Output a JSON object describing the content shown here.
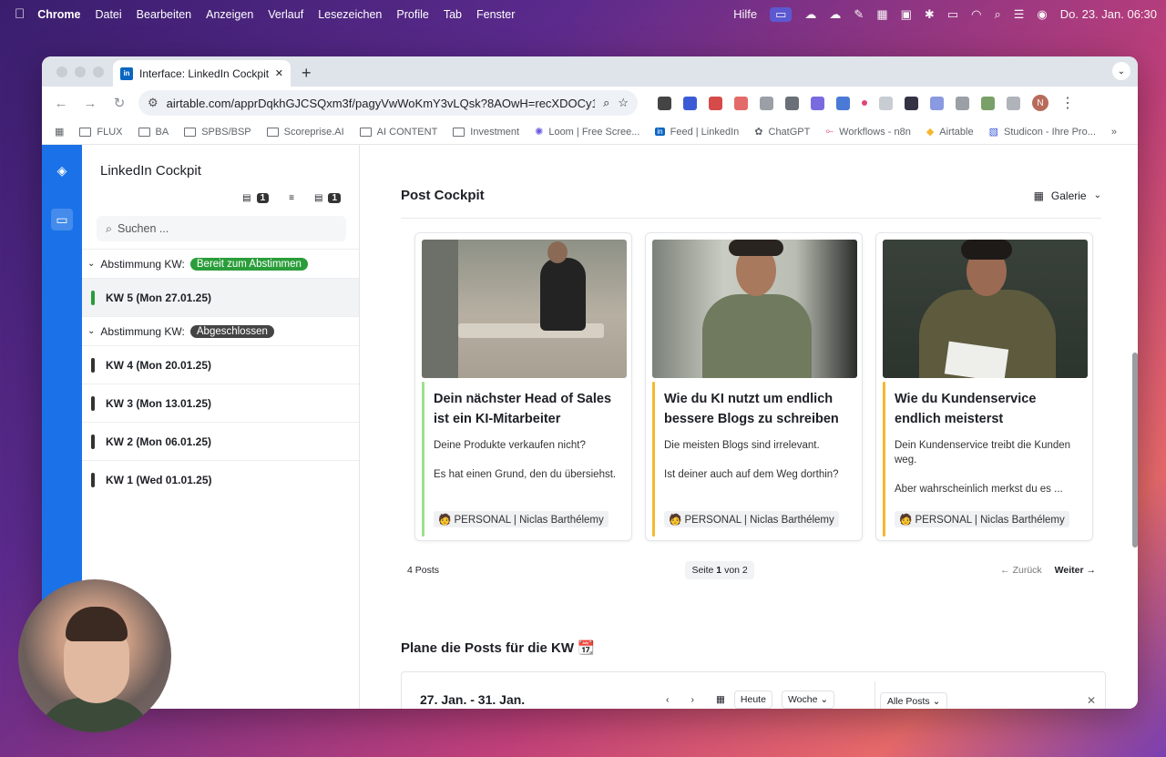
{
  "menubar": {
    "apple": "",
    "app": "Chrome",
    "items": [
      "Datei",
      "Bearbeiten",
      "Anzeigen",
      "Verlauf",
      "Lesezeichen",
      "Profile",
      "Tab",
      "Fenster"
    ],
    "help": "Hilfe",
    "datetime": "Do. 23. Jan.  06:30"
  },
  "browser": {
    "tab_title": "Interface: LinkedIn Cockpit - ",
    "tab_close": "✕",
    "new_tab": "+",
    "url": "airtable.com/apprDqkhGJCSQxm3f/pagyVwWoKmY3vLQsk?8AOwH=recXDOCy1...",
    "profile": "N",
    "bookmarks": [
      "FLUX",
      "BA",
      "SPBS/BSP",
      "Scoreprise.AI",
      "AI CONTENT",
      "Investment",
      "Loom | Free Scree...",
      "Feed | LinkedIn",
      "ChatGPT",
      "Workflows - n8n",
      "Airtable",
      "Studicon - Ihre Pro..."
    ]
  },
  "sidebar": {
    "title": "LinkedIn Cockpit",
    "badge1": "1",
    "badge2": "1",
    "search_placeholder": "Suchen ...",
    "group1": {
      "label": "Abstimmung KW:",
      "status": "Bereit zum Abstimmen",
      "color": "#2a9d3a"
    },
    "group1_items": [
      {
        "label": "KW 5 (Mon 27.01.25)",
        "color": "#2a9d3a"
      }
    ],
    "group2": {
      "label": "Abstimmung KW:",
      "status": "Abgeschlossen",
      "color": "#444"
    },
    "group2_items": [
      {
        "label": "KW 4 (Mon 20.01.25)",
        "color": "#333"
      },
      {
        "label": "KW 3 (Mon 13.01.25)",
        "color": "#333"
      },
      {
        "label": "KW 2 (Mon 06.01.25)",
        "color": "#333"
      },
      {
        "label": "KW 1 (Wed 01.01.25)",
        "color": "#333"
      }
    ]
  },
  "main": {
    "section_title": "Post Cockpit",
    "view_label": "Galerie",
    "cards": [
      {
        "title": "Dein nächster Head of Sales ist ein KI-Mitarbeiter",
        "desc": "Deine Produkte verkaufen nicht?\n\nEs hat einen Grund, den du übersiehst.",
        "tag": "PERSONAL | Niclas Barthélemy",
        "line_color": "#9be08a"
      },
      {
        "title": "Wie du KI nutzt um endlich bessere Blogs zu schreiben",
        "desc": "Die meisten Blogs sind irrelevant.\n\nIst deiner auch auf dem Weg dorthin?",
        "tag": "PERSONAL | Niclas Barthélemy",
        "line_color": "#f5b82e"
      },
      {
        "title": "Wie du Kundenservice endlich meisterst",
        "desc": "Dein Kundenservice treibt die Kunden weg.\n\nAber wahrscheinlich merkst du es ...",
        "tag": "PERSONAL | Niclas Barthélemy",
        "line_color": "#f5b82e"
      }
    ],
    "post_count": "4 Posts",
    "page_prefix": "Seite",
    "page_num": "1",
    "page_suffix": "von 2",
    "back": "Zurück",
    "next": "Weiter",
    "plan_title": "Plane die Posts für die KW 📆",
    "cal_range": "27. Jan. - 31. Jan.",
    "today": "Heute",
    "week": "Woche",
    "all_posts": "Alle Posts"
  }
}
